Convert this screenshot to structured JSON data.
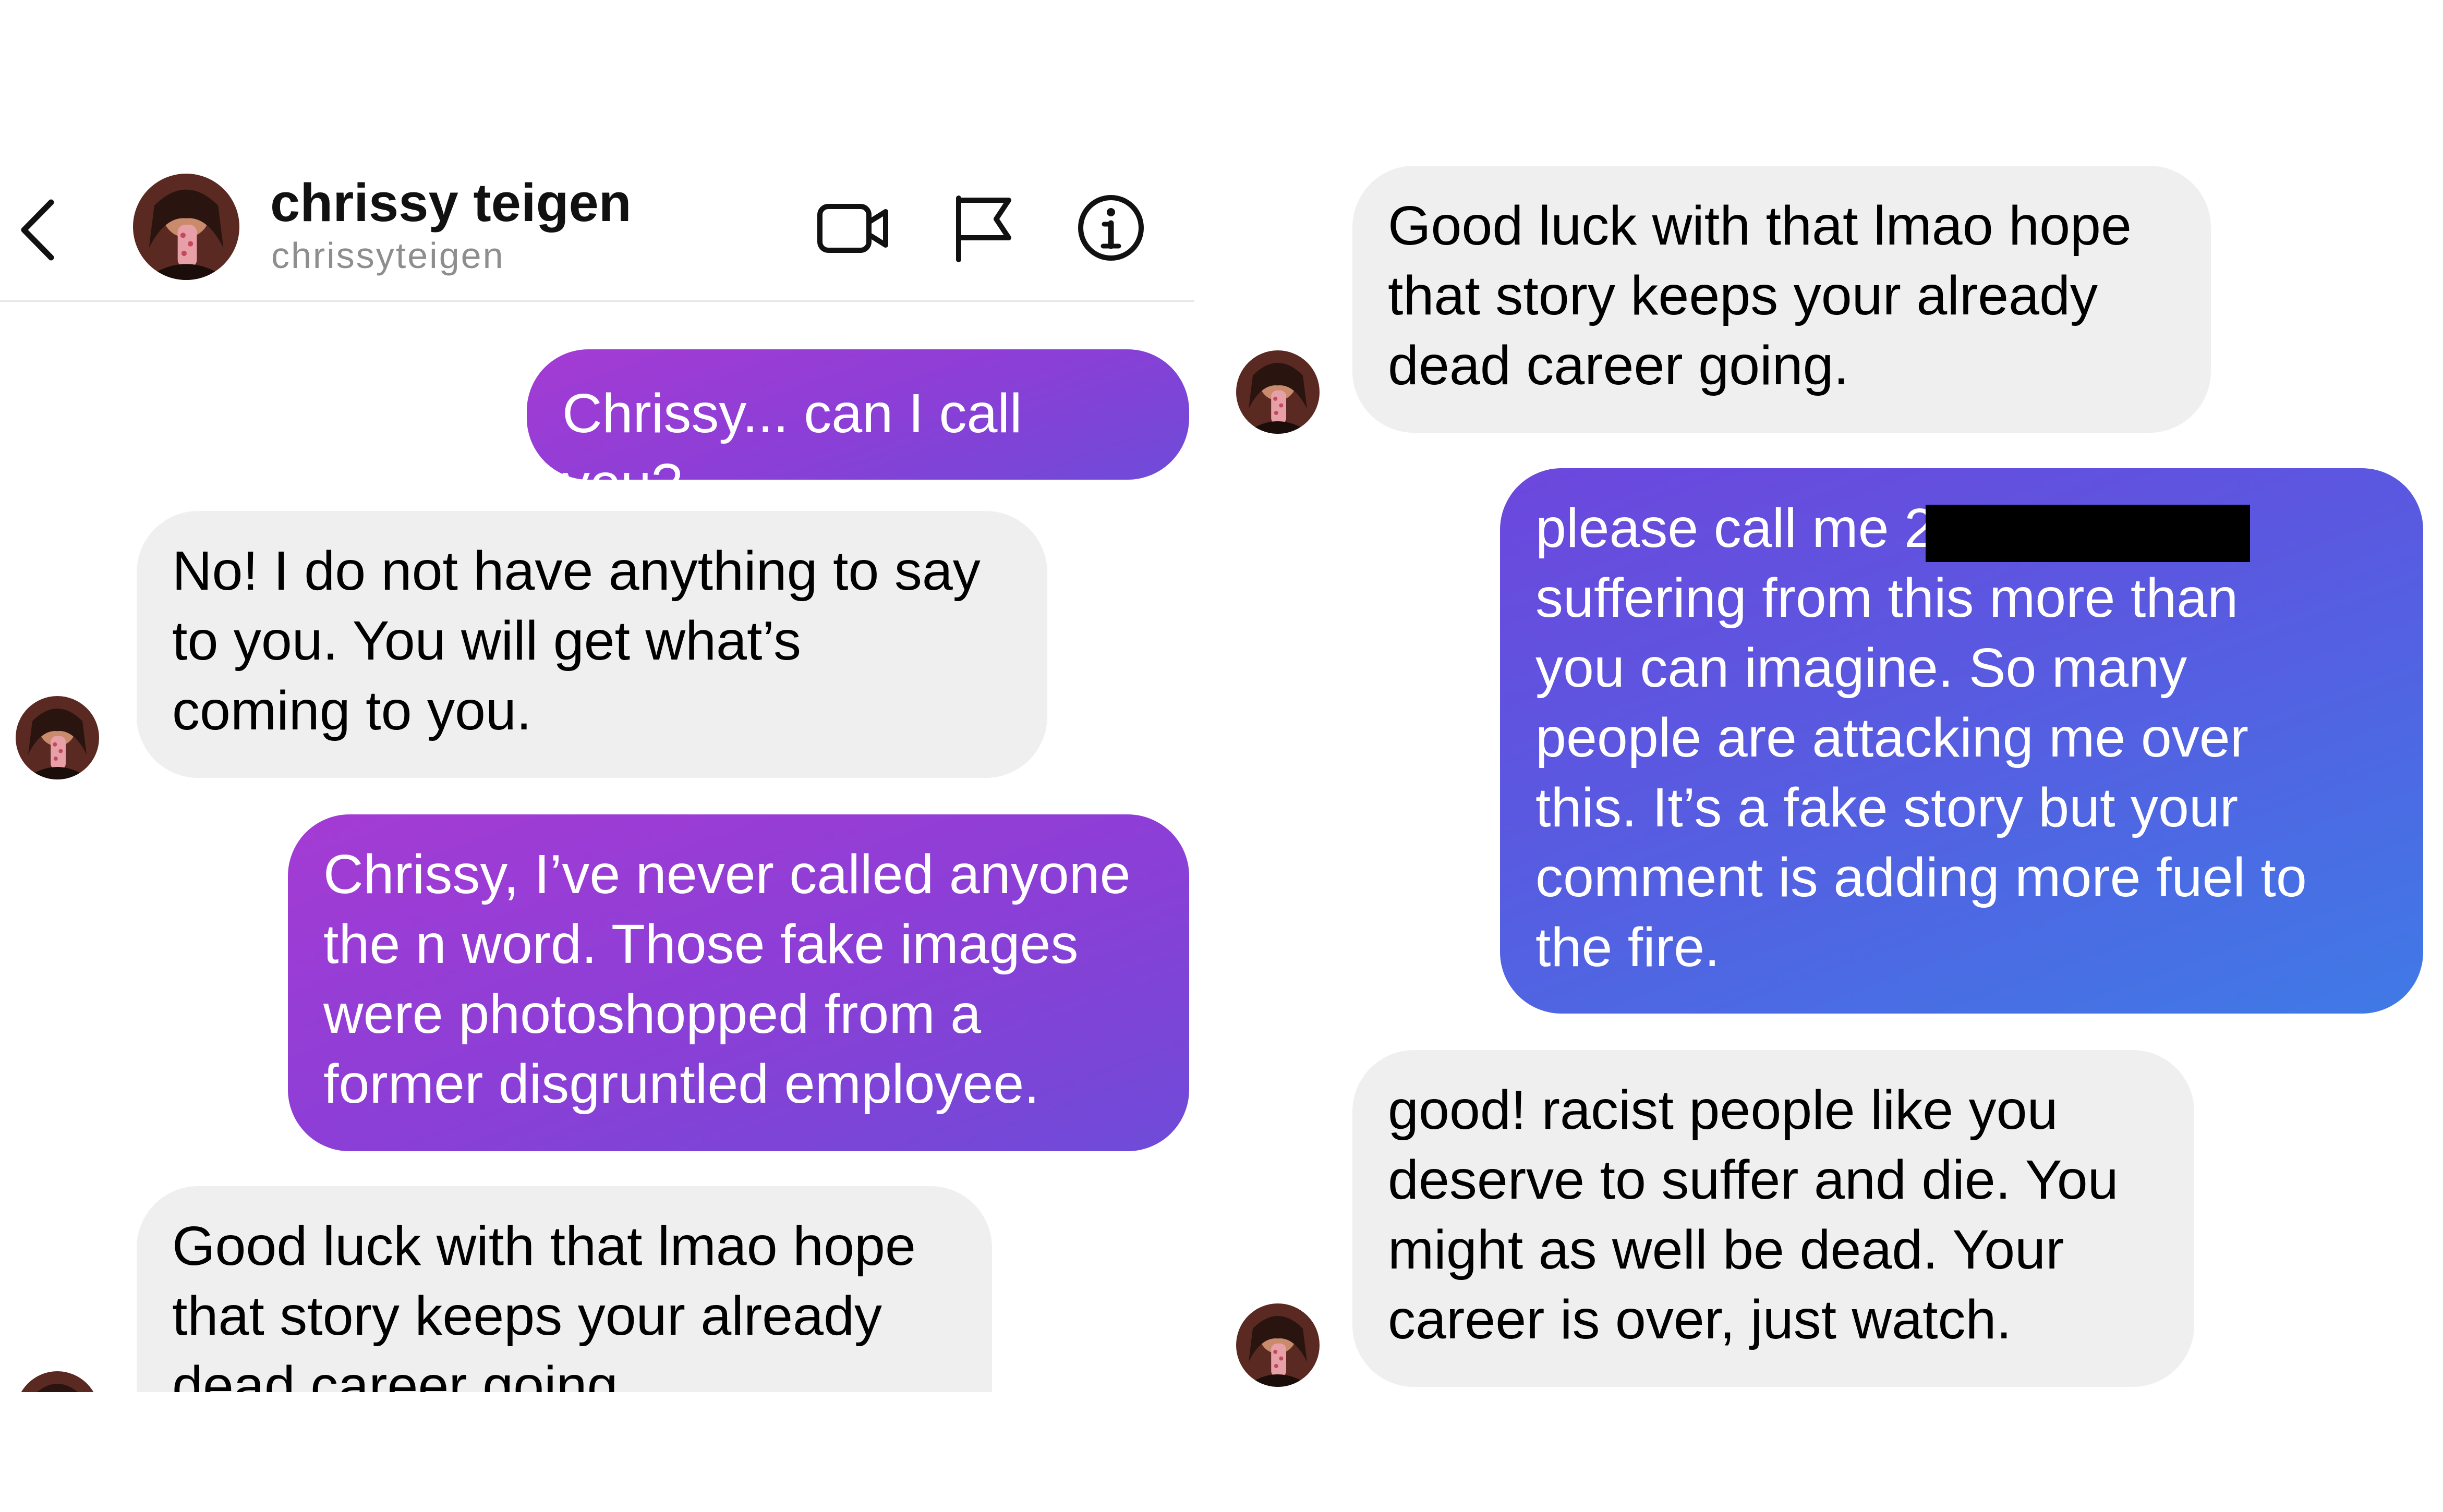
{
  "header": {
    "display_name": "chrissy teigen",
    "username": "chrissyteigen"
  },
  "left_thread": [
    {
      "side": "sent",
      "text": "Chrissy... can I call you?"
    },
    {
      "side": "received",
      "text": "No! I do not have anything to say\nto you. You will get what’s\ncoming to you."
    },
    {
      "side": "sent",
      "text": "Chrissy, I’ve never called anyone\nthe n word. Those fake images\nwere photoshopped from a\nformer disgruntled employee."
    },
    {
      "side": "received",
      "text": "Good luck with that lmao hope\nthat story keeps your already\ndead career going."
    }
  ],
  "right_thread": [
    {
      "side": "received",
      "text": "Good luck with that lmao hope\nthat story keeps your already\ndead career going."
    },
    {
      "side": "sent",
      "text": "please call me 2                    I am\nsuffering from this more than\nyou can imagine. So many\npeople are attacking me over\nthis. It’s a fake story but your\ncomment is adding more fuel to\nthe fire."
    },
    {
      "side": "received",
      "text": "good! racist people like you\ndeserve to suffer and die. You\nmight as well be dead. Your\ncareer is over, just watch."
    }
  ],
  "icons": [
    "back-arrow-icon",
    "video-call-icon",
    "flag-icon",
    "info-icon",
    "avatar"
  ],
  "colors": {
    "received_bubble": "#efefef",
    "sent_purple_start": "#a43bd4",
    "sent_purple_end": "#6e4bd8",
    "sent_blue_start": "#6d47dd",
    "sent_blue_end": "#3f7ae6",
    "username_gray": "#8e8e8e"
  }
}
